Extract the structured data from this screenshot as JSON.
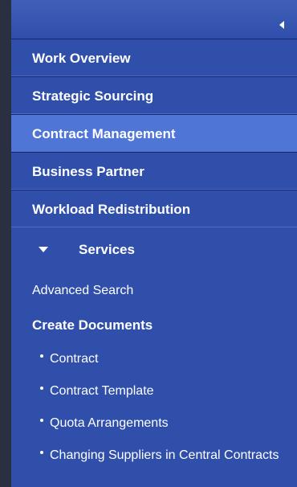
{
  "nav": {
    "items": [
      {
        "label": "Work Overview"
      },
      {
        "label": "Strategic Sourcing"
      },
      {
        "label": "Contract Management",
        "active": true
      },
      {
        "label": "Business Partner"
      },
      {
        "label": "Workload Redistribution"
      }
    ]
  },
  "services": {
    "label": "Services",
    "advanced_search": "Advanced Search",
    "create_documents": "Create Documents",
    "documents": [
      {
        "label": "Contract"
      },
      {
        "label": "Contract Template"
      },
      {
        "label": "Quota Arrangements"
      },
      {
        "label": "Changing Suppliers in Central Contracts"
      }
    ]
  },
  "icons": {
    "collapse": "chevron-left-icon",
    "services_toggle": "triangle-down-icon",
    "document_bullet": "bullet-icon"
  },
  "colors": {
    "menu_bg": "#2f4fab",
    "active_bg": "#4f75d6",
    "text": "#ffffff",
    "left_edge": "#2a2f41"
  }
}
